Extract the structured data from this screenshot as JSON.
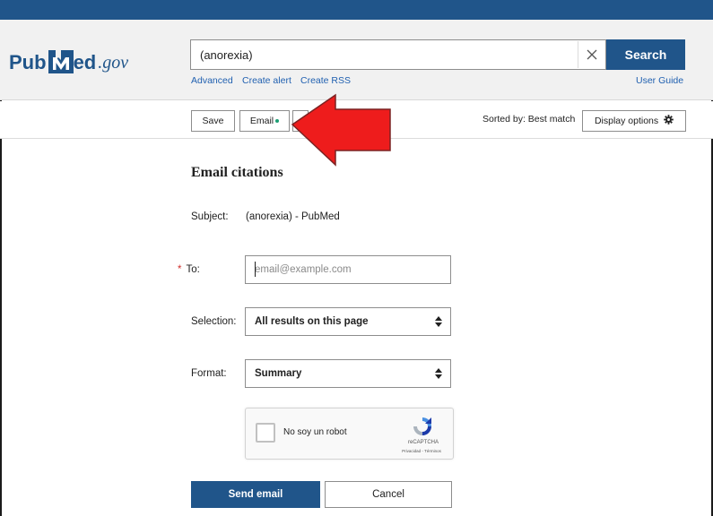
{
  "header": {
    "logo": {
      "pub": "Pub",
      "ed": "ed",
      "gov": ".gov"
    },
    "search": {
      "value": "(anorexia)",
      "button_label": "Search"
    },
    "links": {
      "advanced": "Advanced",
      "create_alert": "Create alert",
      "create_rss": "Create RSS",
      "user_guide": "User Guide"
    }
  },
  "toolbar": {
    "save_label": "Save",
    "email_label": "Email",
    "sorted_by": "Sorted by: Best match",
    "display_options_label": "Display options"
  },
  "email_form": {
    "title": "Email citations",
    "subject_label": "Subject:",
    "subject_value": "(anorexia) - PubMed",
    "to_required_mark": "*",
    "to_label": "To:",
    "to_placeholder": "email@example.com",
    "selection_label": "Selection:",
    "selection_value": "All results on this page",
    "format_label": "Format:",
    "format_value": "Summary",
    "recaptcha": {
      "label": "No soy un robot",
      "brand": "reCAPTCHA",
      "terms": "Privacidad - Términos"
    },
    "send_label": "Send email",
    "cancel_label": "Cancel"
  },
  "colors": {
    "brand_blue": "#20558a",
    "arrow_red": "#ee1c1c",
    "required_red": "#d0302c",
    "email_dot_green": "#1d9e74"
  },
  "annotation": {
    "icon": "red-arrow-pointer-icon"
  }
}
